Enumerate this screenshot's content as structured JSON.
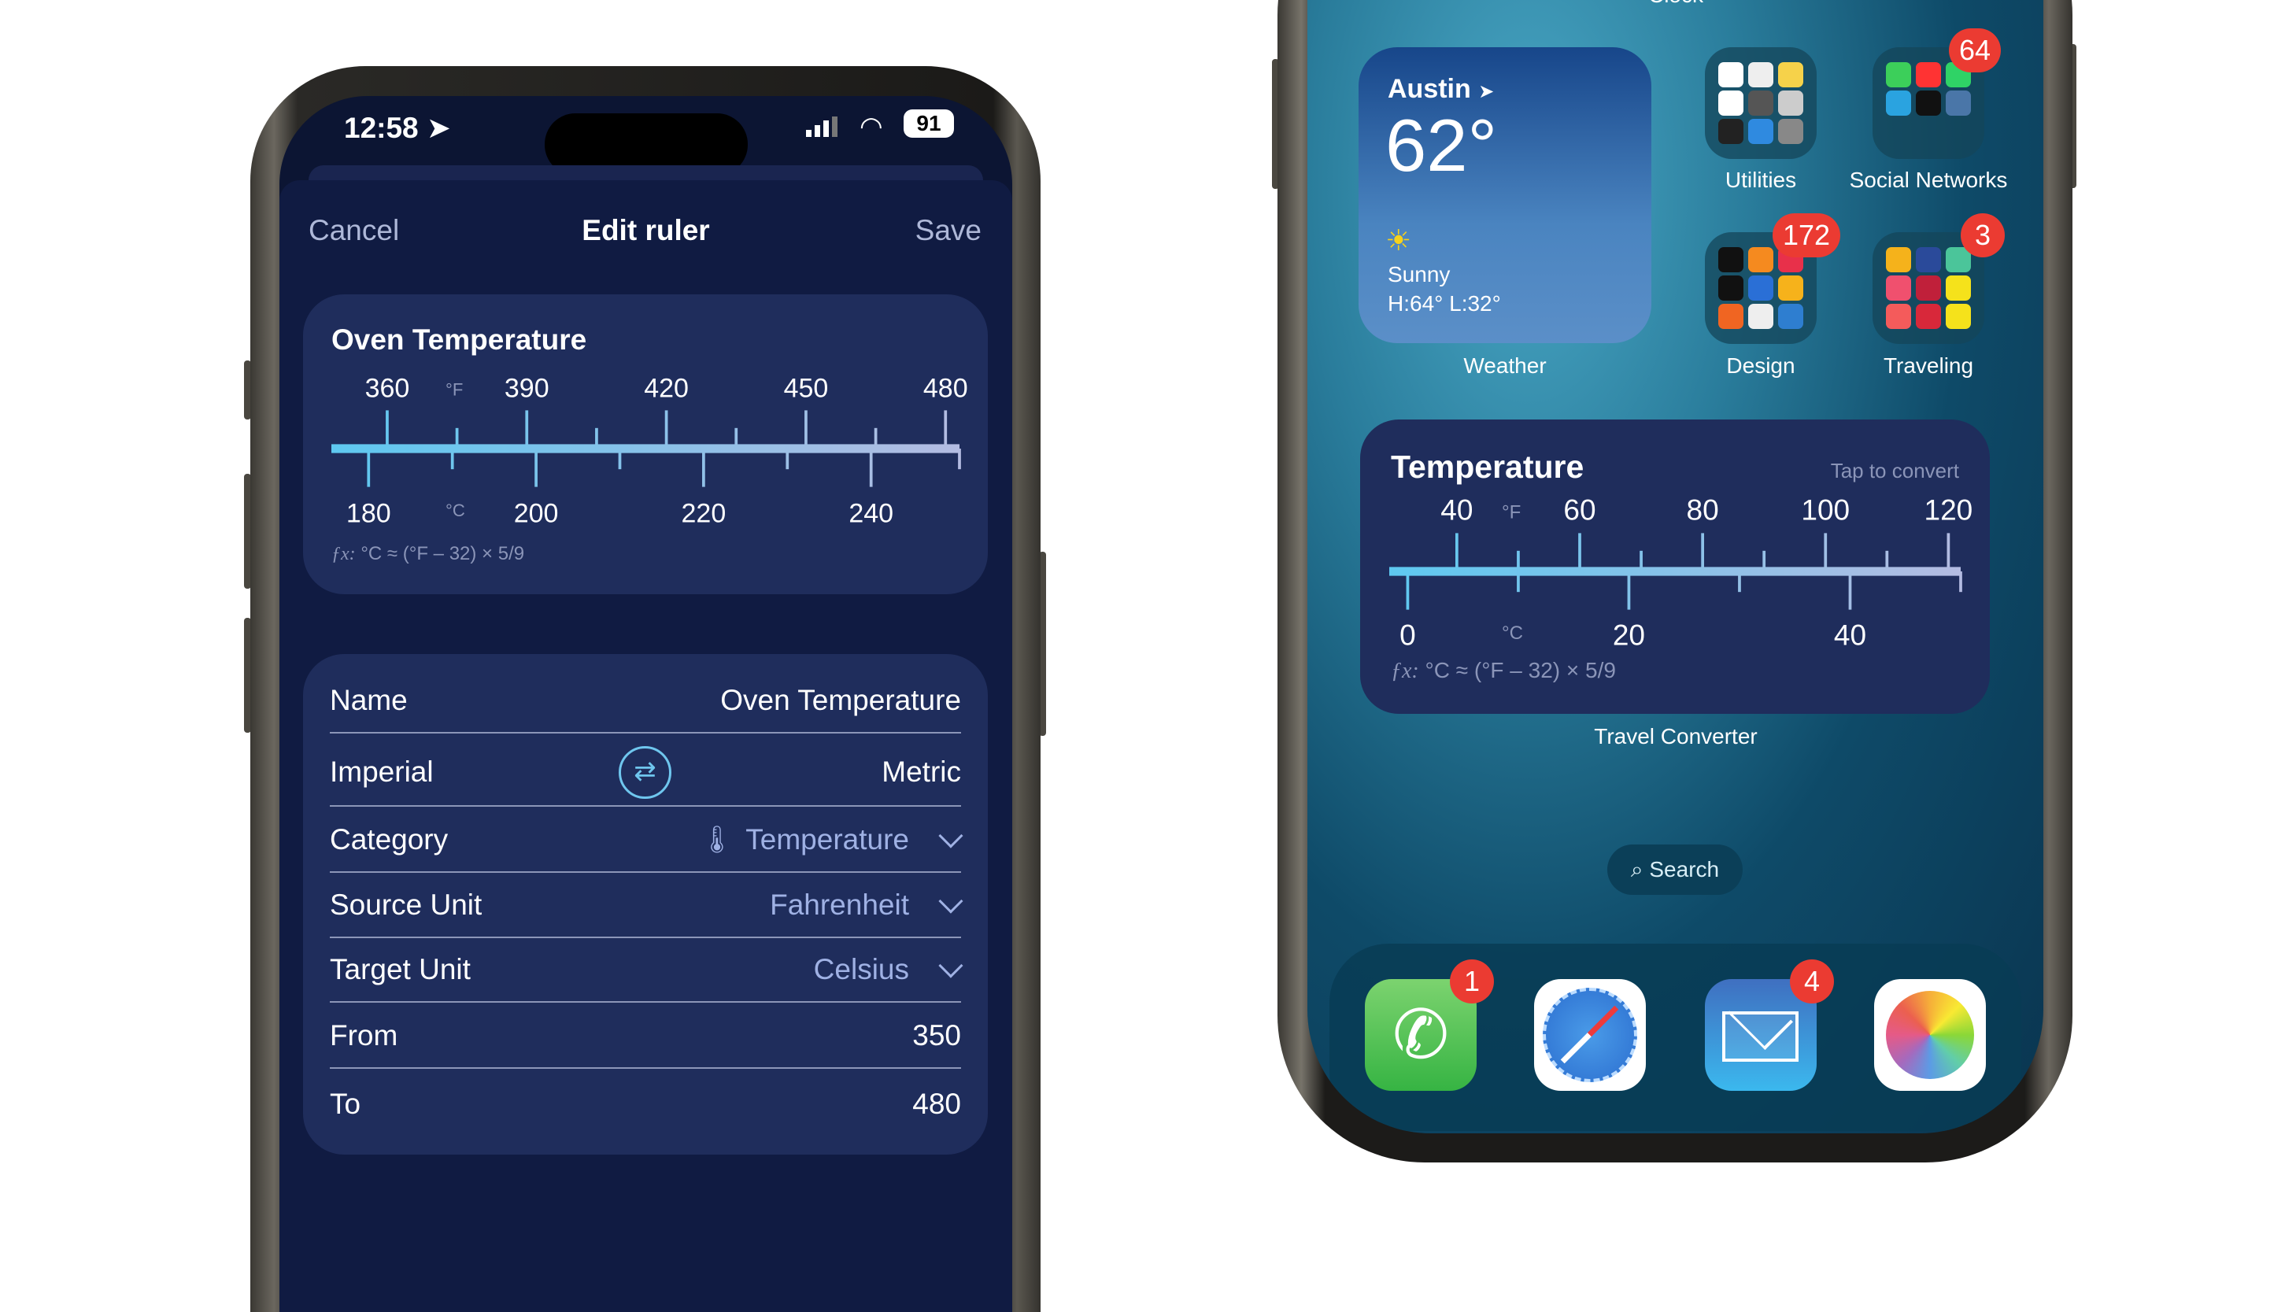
{
  "left_phone": {
    "status_bar": {
      "time": "12:58",
      "battery": "91",
      "icons": [
        "location-arrow-icon",
        "signal-icon",
        "wifi-icon",
        "battery-icon"
      ]
    },
    "header": {
      "cancel": "Cancel",
      "title": "Edit ruler",
      "save": "Save"
    },
    "ruler": {
      "title": "Oven Temperature",
      "top_unit": "°F",
      "bottom_unit": "°C",
      "f_range": [
        348,
        483
      ],
      "f_major": [
        360,
        390,
        420,
        450,
        480
      ],
      "f_minor": [
        375,
        405,
        435,
        465
      ],
      "c_major": [
        180,
        200,
        220,
        240
      ],
      "c_minor": [
        190,
        210,
        230
      ],
      "formula_prefix": "ƒx:",
      "formula": "°C ≈ (°F – 32) × 5/9"
    },
    "form": {
      "name": {
        "label": "Name",
        "value": "Oven Temperature"
      },
      "systems": {
        "left": "Imperial",
        "right": "Metric",
        "swap_icon": "swap-arrows-icon"
      },
      "category": {
        "label": "Category",
        "value": "Temperature",
        "icon": "thermometer-icon"
      },
      "source_unit": {
        "label": "Source Unit",
        "value": "Fahrenheit"
      },
      "target_unit": {
        "label": "Target Unit",
        "value": "Celsius"
      },
      "from": {
        "label": "From",
        "value": "350"
      },
      "to": {
        "label": "To",
        "value": "480"
      }
    },
    "colors": {
      "accent": "#9fb1e4",
      "ruler_start": "#5ec8f0",
      "ruler_end": "#b4bce2",
      "card": "#1f2d5c"
    }
  },
  "right_phone": {
    "top_label": "Clock",
    "weather": {
      "city": "Austin",
      "temp": "62°",
      "condition": "Sunny",
      "hilo": "H:64° L:32°",
      "label": "Weather"
    },
    "folders": [
      {
        "label": "Utilities",
        "badge": ""
      },
      {
        "label": "Social Networks",
        "badge": "64"
      },
      {
        "label": "Design",
        "badge": "172"
      },
      {
        "label": "Traveling",
        "badge": "3"
      }
    ],
    "converter": {
      "title": "Temperature",
      "hint": "Tap to convert",
      "label": "Travel Converter",
      "top_unit": "°F",
      "bottom_unit": "°C",
      "f_range": [
        29,
        122
      ],
      "f_major": [
        40,
        60,
        80,
        100,
        120
      ],
      "f_minor": [
        50,
        70,
        90,
        110
      ],
      "c_major": [
        0,
        20,
        40
      ],
      "c_minor": [
        10,
        30
      ],
      "formula_prefix": "ƒx:",
      "formula": "°C ≈ (°F – 32) × 5/9"
    },
    "search": "Search",
    "dock": [
      {
        "name": "phone",
        "badge": "1"
      },
      {
        "name": "safari",
        "badge": ""
      },
      {
        "name": "mail",
        "badge": "4"
      },
      {
        "name": "photos",
        "badge": ""
      }
    ]
  }
}
